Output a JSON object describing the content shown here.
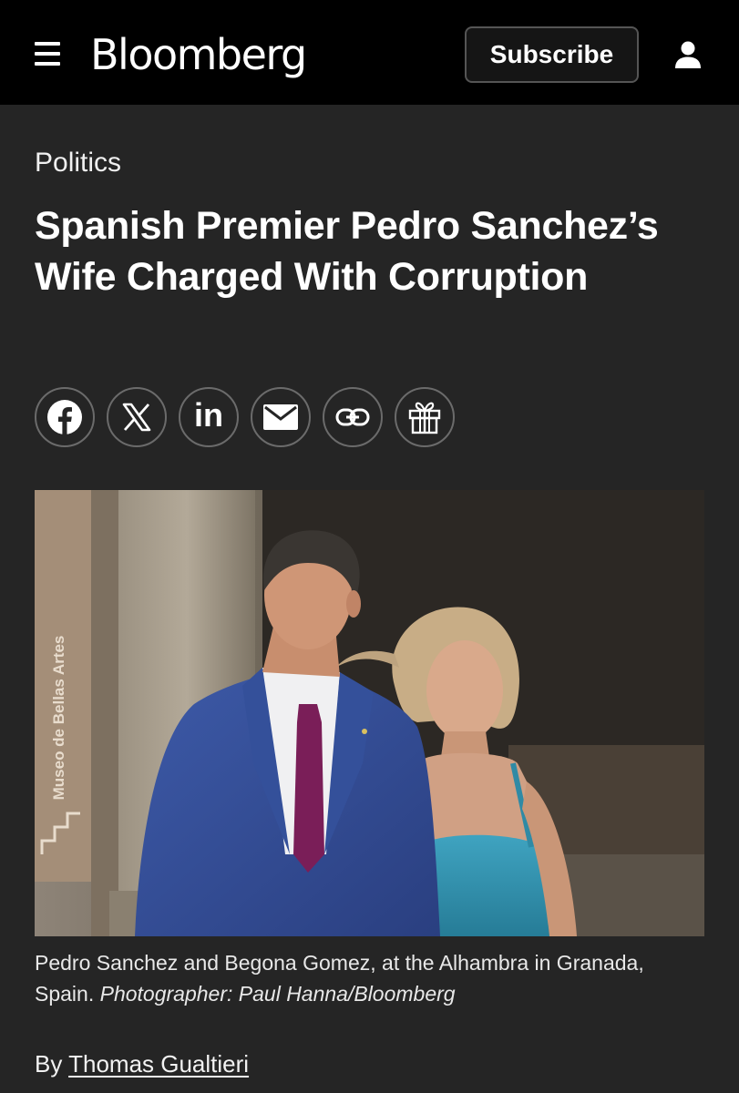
{
  "header": {
    "logo": "Bloomberg",
    "subscribe_label": "Subscribe",
    "menu_icon": "hamburger-menu-icon",
    "user_icon": "user-account-icon"
  },
  "article": {
    "section": "Politics",
    "headline": "Spanish Premier Pedro Sanchez’s Wife Charged With Corruption",
    "share_buttons": [
      {
        "icon": "facebook-icon"
      },
      {
        "icon": "x-icon"
      },
      {
        "icon": "linkedin-icon",
        "label": "in"
      },
      {
        "icon": "email-icon"
      },
      {
        "icon": "link-icon"
      },
      {
        "icon": "gift-icon"
      }
    ],
    "photo": {
      "sign_text": "Museo de Bellas Artes"
    },
    "caption": {
      "text": "Pedro Sanchez and Begona Gomez, at the Alhambra in Granada, Spain.",
      "credit": "Photographer: Paul Hanna/Bloomberg"
    },
    "byline": {
      "prefix": "By",
      "author": "Thomas Gualtieri"
    }
  },
  "colors": {
    "topbar": "#000000",
    "page_background": "#252525",
    "text": "#ffffff",
    "button_border": "#6b6b6b"
  }
}
